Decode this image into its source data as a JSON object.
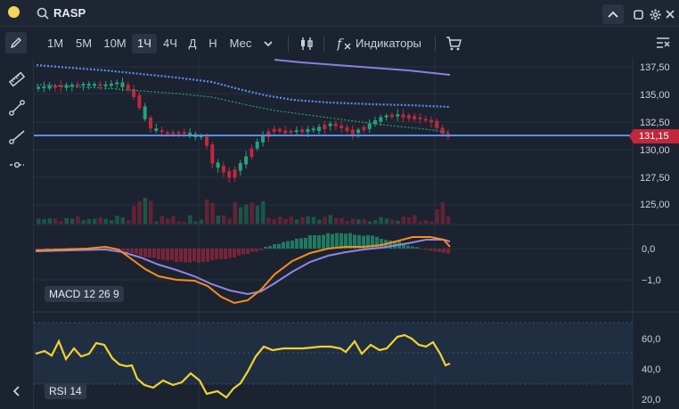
{
  "header": {
    "ticker": "RASP",
    "ticker_color": "#f5d65a"
  },
  "toolbar": {
    "timeframes": [
      "1М",
      "5М",
      "10М",
      "1Ч",
      "4Ч",
      "Д",
      "Н",
      "Мес"
    ],
    "active_timeframe": "1Ч",
    "indicators_label": "Индикаторы"
  },
  "colors": {
    "up": "#26a17b",
    "down": "#c2273b",
    "ma_long": "#8b7fe0",
    "ma_blue": "#5b8ef0",
    "ma_green": "#2f9e6e",
    "price_line": "#5b8ef0",
    "macd": "#ff8c1a",
    "signal": "#8f86e0",
    "rsi": "#f2d22e"
  },
  "price_axis": {
    "labels": [
      "137,50",
      "135,00",
      "132,50",
      "130,00",
      "127,50",
      "125,00"
    ],
    "current_price": "131,15"
  },
  "macd": {
    "label": "MACD 12 26 9",
    "axis": [
      "0,0",
      "−1,0"
    ]
  },
  "rsi": {
    "label": "RSI 14",
    "axis": [
      "60,0",
      "40,0",
      "20,0"
    ]
  }
}
